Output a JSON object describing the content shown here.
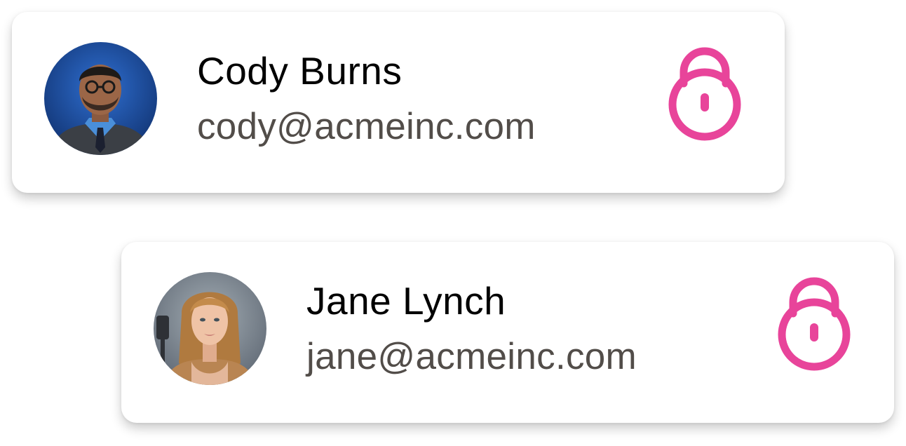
{
  "users": [
    {
      "name": "Cody Burns",
      "email": "cody@acmeinc.com",
      "avatar_bg": "#1d4fa3",
      "lock_icon": "lock-icon"
    },
    {
      "name": "Jane Lynch",
      "email": "jane@acmeinc.com",
      "avatar_bg": "#7f8a93",
      "lock_icon": "lock-icon"
    }
  ],
  "colors": {
    "lock": "#e8449a",
    "name": "#000000",
    "email": "#524d49"
  }
}
